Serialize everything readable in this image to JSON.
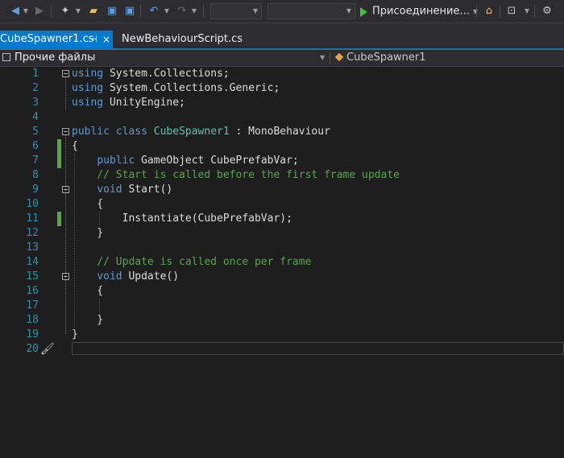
{
  "toolbar": {
    "run_label": "Присоединение...",
    "icons": [
      "back-icon",
      "forward-icon",
      "new-project-icon",
      "open-icon",
      "save-icon",
      "save-all-icon",
      "undo-icon",
      "redo-icon",
      "play-icon",
      "folder-view-icon",
      "solution-view-icon"
    ]
  },
  "tabs": [
    {
      "label": "CubeSpawner1.cs",
      "active": true,
      "pin": "⊣",
      "close": "×"
    },
    {
      "label": "NewBehaviourScript.cs",
      "active": false
    }
  ],
  "navbar": {
    "project": "Прочие файлы",
    "type": "CubeSpawner1"
  },
  "editor": {
    "lines": [
      {
        "n": "1",
        "tokens": [
          [
            "kw",
            "using"
          ],
          [
            "",
            "System.Collections;"
          ]
        ]
      },
      {
        "n": "2",
        "tokens": [
          [
            "kw",
            "using"
          ],
          [
            "",
            "System.Collections.Generic;"
          ]
        ]
      },
      {
        "n": "3",
        "tokens": [
          [
            "kw",
            "using"
          ],
          [
            "",
            "UnityEngine;"
          ]
        ]
      },
      {
        "n": "4",
        "tokens": []
      },
      {
        "n": "5",
        "tokens": [
          [
            "kw",
            "public"
          ],
          [
            "kw",
            "class"
          ],
          [
            "cls",
            "CubeSpawner1"
          ],
          [
            "",
            " : MonoBehaviour"
          ]
        ]
      },
      {
        "n": "6",
        "tokens": [
          [
            "",
            "{"
          ]
        ]
      },
      {
        "n": "7",
        "tokens": [
          [
            "",
            ""
          ],
          [
            "kw",
            "public"
          ],
          [
            "",
            "GameObject CubePrefabVar;"
          ]
        ]
      },
      {
        "n": "8",
        "tokens": [
          [
            "cm",
            "    // Start is called before the first frame update"
          ]
        ]
      },
      {
        "n": "9",
        "tokens": [
          [
            "",
            ""
          ],
          [
            "kw",
            "void"
          ],
          [
            "",
            "Start()"
          ]
        ]
      },
      {
        "n": "10",
        "tokens": [
          [
            "",
            "    {"
          ]
        ]
      },
      {
        "n": "11",
        "tokens": [
          [
            "",
            "        Instantiate(CubePrefabVar);"
          ]
        ]
      },
      {
        "n": "12",
        "tokens": [
          [
            "",
            "    }"
          ]
        ]
      },
      {
        "n": "13",
        "tokens": []
      },
      {
        "n": "14",
        "tokens": [
          [
            "cm",
            "    // Update is called once per frame"
          ]
        ]
      },
      {
        "n": "15",
        "tokens": [
          [
            "",
            ""
          ],
          [
            "kw",
            "void"
          ],
          [
            "",
            "Update()"
          ]
        ]
      },
      {
        "n": "16",
        "tokens": [
          [
            "",
            "    {"
          ]
        ]
      },
      {
        "n": "17",
        "tokens": []
      },
      {
        "n": "18",
        "tokens": [
          [
            "",
            "    }"
          ]
        ]
      },
      {
        "n": "19",
        "tokens": [
          [
            "",
            "}"
          ]
        ]
      },
      {
        "n": "20",
        "tokens": []
      }
    ]
  },
  "colors": {
    "accent": "#007acc",
    "keyword": "#569cd6",
    "type": "#4ec9b0",
    "comment": "#57a64a",
    "line_number": "#2b91af",
    "changed_marker": "#57a64a"
  }
}
